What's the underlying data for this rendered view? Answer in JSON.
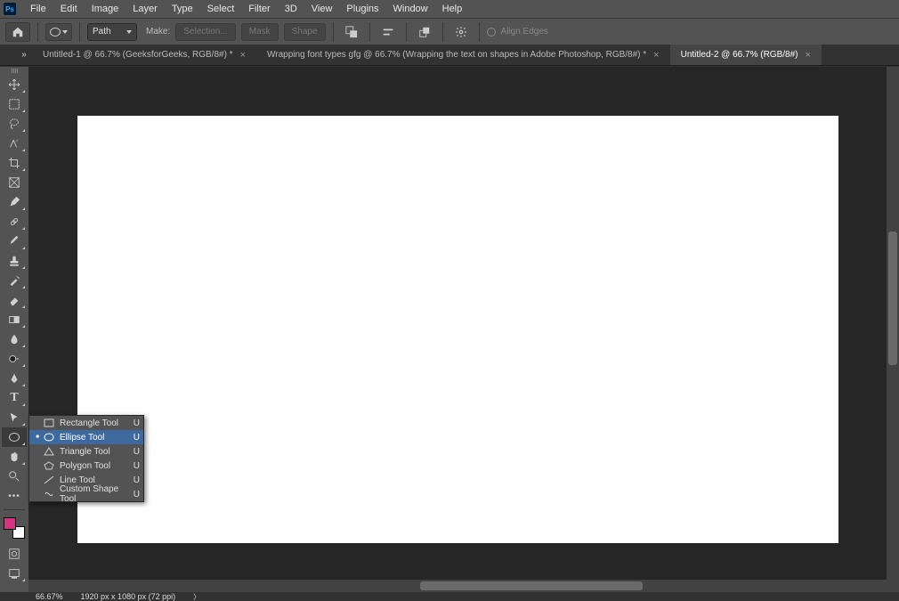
{
  "menu": [
    "File",
    "Edit",
    "Image",
    "Layer",
    "Type",
    "Select",
    "Filter",
    "3D",
    "View",
    "Plugins",
    "Window",
    "Help"
  ],
  "options": {
    "mode": "Path",
    "make_label": "Make:",
    "selection_btn": "Selection...",
    "mask_btn": "Mask",
    "shape_btn": "Shape",
    "align_label": "Align Edges"
  },
  "tabs": [
    {
      "title": "Untitled-1 @ 66.7% (GeeksforGeeks, RGB/8#) *",
      "active": false
    },
    {
      "title": "Wrapping font types gfg @ 66.7% (Wrapping the text on shapes in Adobe Photoshop, RGB/8#) *",
      "active": false
    },
    {
      "title": "Untitled-2 @ 66.7% (RGB/8#)",
      "active": true
    }
  ],
  "flyout": [
    {
      "label": "Rectangle Tool",
      "key": "U",
      "current": false
    },
    {
      "label": "Ellipse Tool",
      "key": "U",
      "current": true
    },
    {
      "label": "Triangle Tool",
      "key": "U",
      "current": false
    },
    {
      "label": "Polygon Tool",
      "key": "U",
      "current": false
    },
    {
      "label": "Line Tool",
      "key": "U",
      "current": false
    },
    {
      "label": "Custom Shape Tool",
      "key": "U",
      "current": false
    }
  ],
  "status": {
    "zoom": "66.67%",
    "dims": "1920 px x 1080 px (72 ppi)"
  },
  "ps": "Ps"
}
